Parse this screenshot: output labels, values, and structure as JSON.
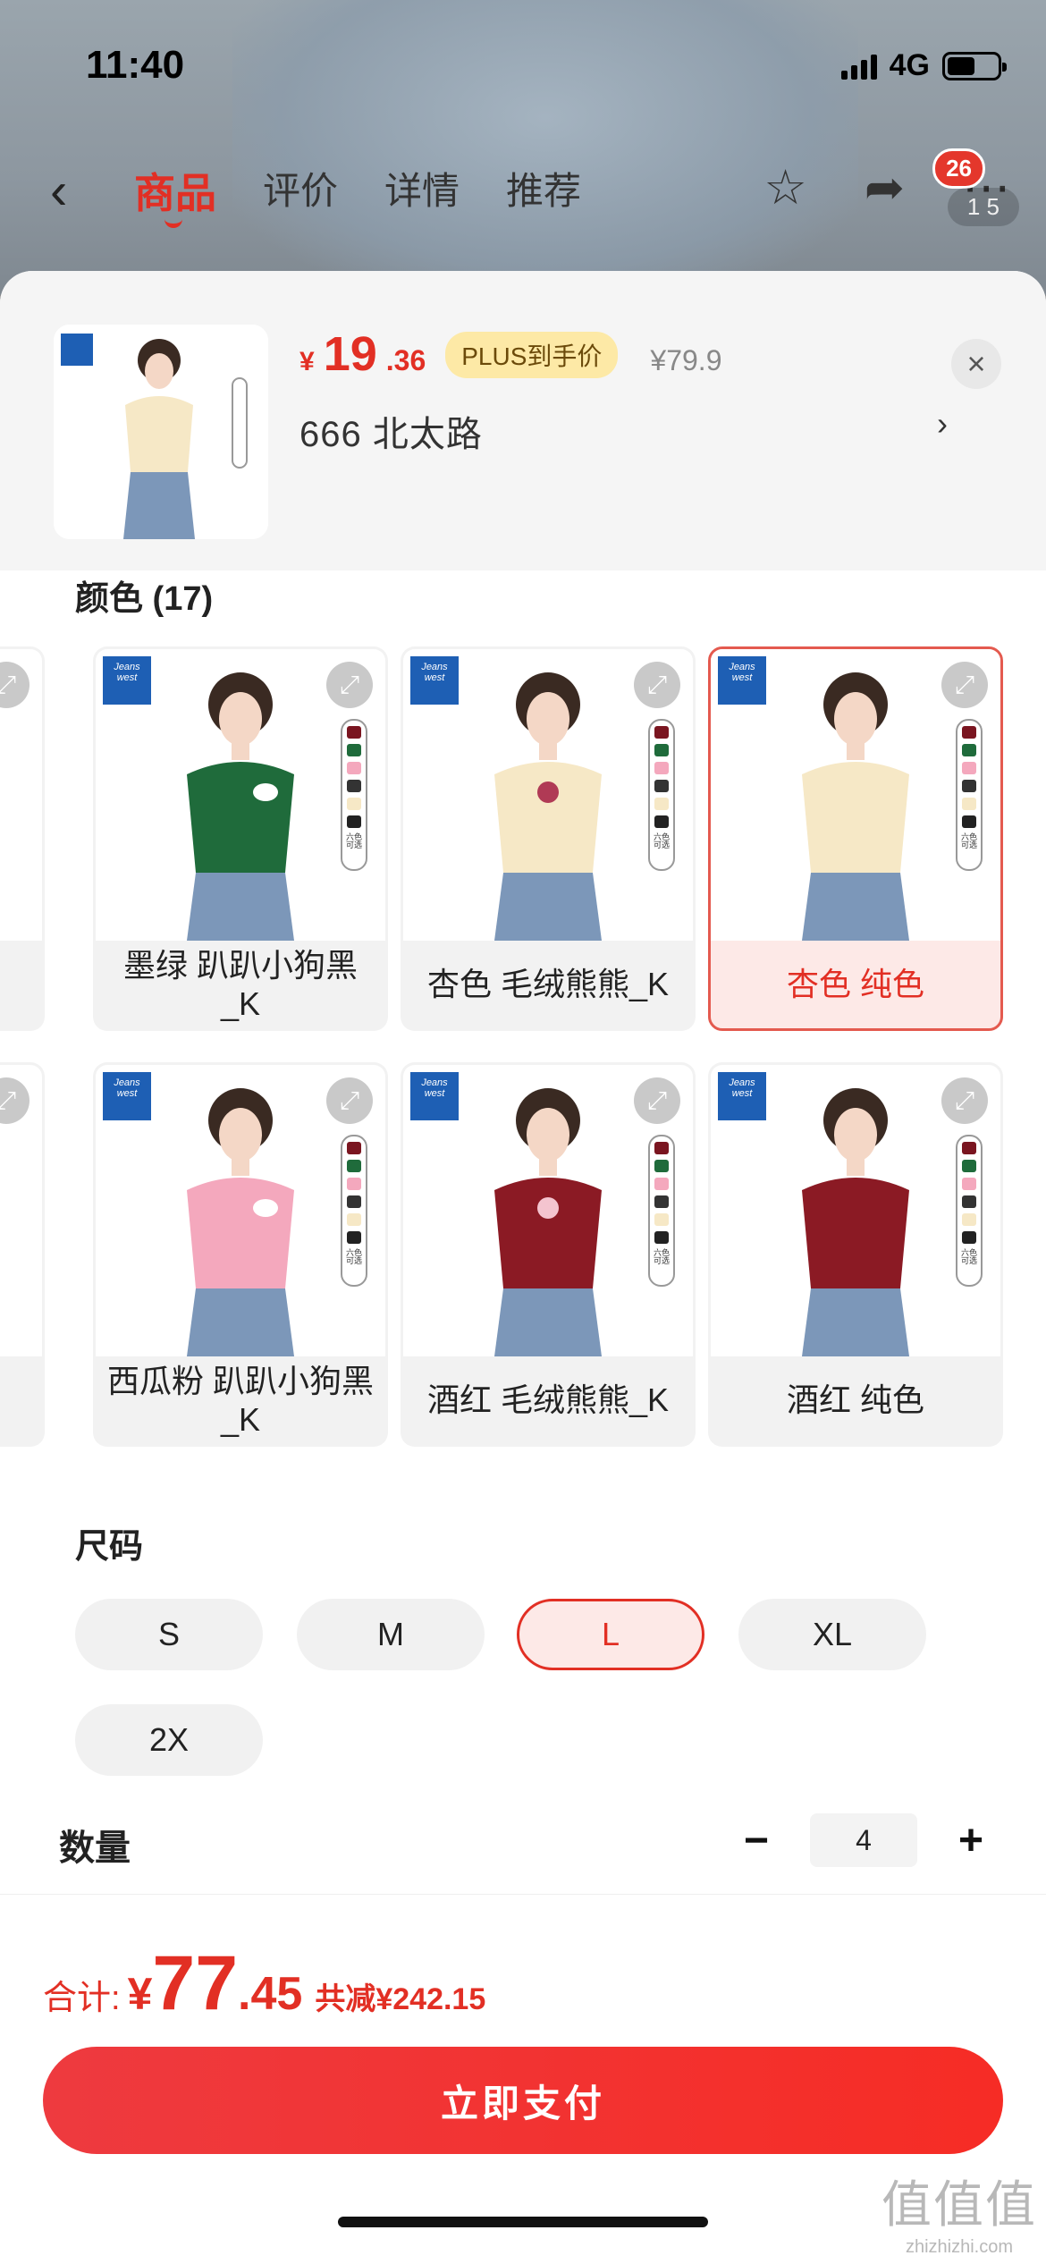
{
  "status_bar": {
    "time": "11:40",
    "network": "4G"
  },
  "nav": {
    "tabs": [
      "商品",
      "评价",
      "详情",
      "推荐"
    ],
    "active_tab": "商品",
    "badge": "26",
    "pager": "1  5"
  },
  "product": {
    "price_symbol": "¥",
    "price_int": "19",
    "price_dec": ".36",
    "plus_tag": "PLUS到手价",
    "original_price": "¥79.9",
    "store": "666  北太路",
    "store_arrow": "›"
  },
  "colors": {
    "title": "颜色 (17)",
    "items": [
      {
        "label": "墨绿 趴趴小狗黑_K",
        "shirt": "#1f6b3b"
      },
      {
        "label": "杏色 毛绒熊熊_K",
        "shirt": "#f6e8c6"
      },
      {
        "label": "杏色 纯色",
        "shirt": "#f6e8c6",
        "selected": true
      },
      {
        "label": "西瓜粉 趴趴小狗黑_K",
        "shirt": "#f4a8bd"
      },
      {
        "label": "酒红 毛绒熊熊_K",
        "shirt": "#8b1a24"
      },
      {
        "label": "酒红 纯色",
        "shirt": "#8b1a24"
      }
    ]
  },
  "sizes": {
    "title": "尺码",
    "items": [
      "S",
      "M",
      "L",
      "XL",
      "2X"
    ],
    "selected": "L"
  },
  "quantity": {
    "label": "数量",
    "value": "4",
    "minus": "−",
    "plus": "+"
  },
  "footer": {
    "total_label": "合计:",
    "total_symbol": "¥",
    "total_int": "77",
    "total_dec": ".45",
    "discount": "共减¥242.15",
    "pay_button": "立即支付"
  },
  "watermark": {
    "big": "值值值",
    "small": "zhizhizhi.com"
  },
  "brand_colors": {
    "accent": "#e22f24",
    "plus_bg": "#fde9a6"
  }
}
